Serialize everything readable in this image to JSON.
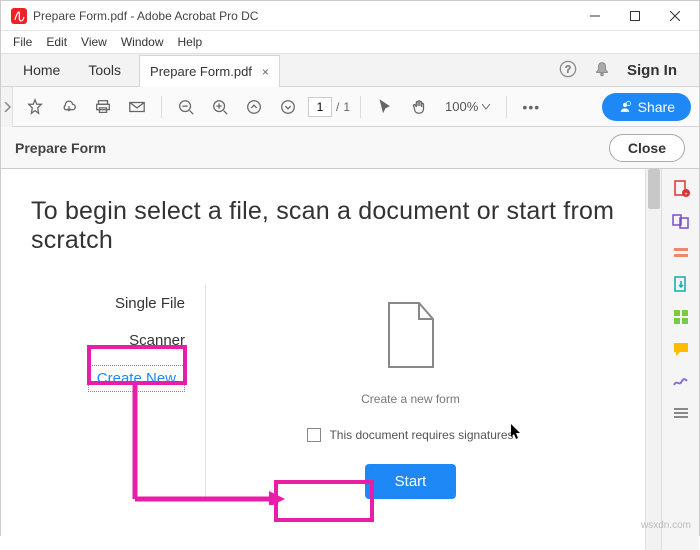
{
  "window": {
    "title": "Prepare Form.pdf - Adobe Acrobat Pro DC",
    "min": "–",
    "max": "☐",
    "close": "✕"
  },
  "menu": {
    "file": "File",
    "edit": "Edit",
    "view": "View",
    "window": "Window",
    "help": "Help"
  },
  "tabs": {
    "home": "Home",
    "tools": "Tools",
    "doc": "Prepare Form.pdf",
    "docClose": "×"
  },
  "header": {
    "signin": "Sign In"
  },
  "toolbar": {
    "page_current": "1",
    "page_sep": "/",
    "page_total": "1",
    "zoom": "100%",
    "more": "•••",
    "share": "Share"
  },
  "secbar": {
    "title": "Prepare Form",
    "close": "Close"
  },
  "main": {
    "headline": "To begin select a file, scan a document or start from scratch",
    "options": {
      "single": "Single File",
      "scanner": "Scanner",
      "create": "Create New"
    },
    "subtext": "Create a new form",
    "checkbox_label": "This document requires signatures",
    "start": "Start"
  },
  "watermark": "wsxdn.com"
}
